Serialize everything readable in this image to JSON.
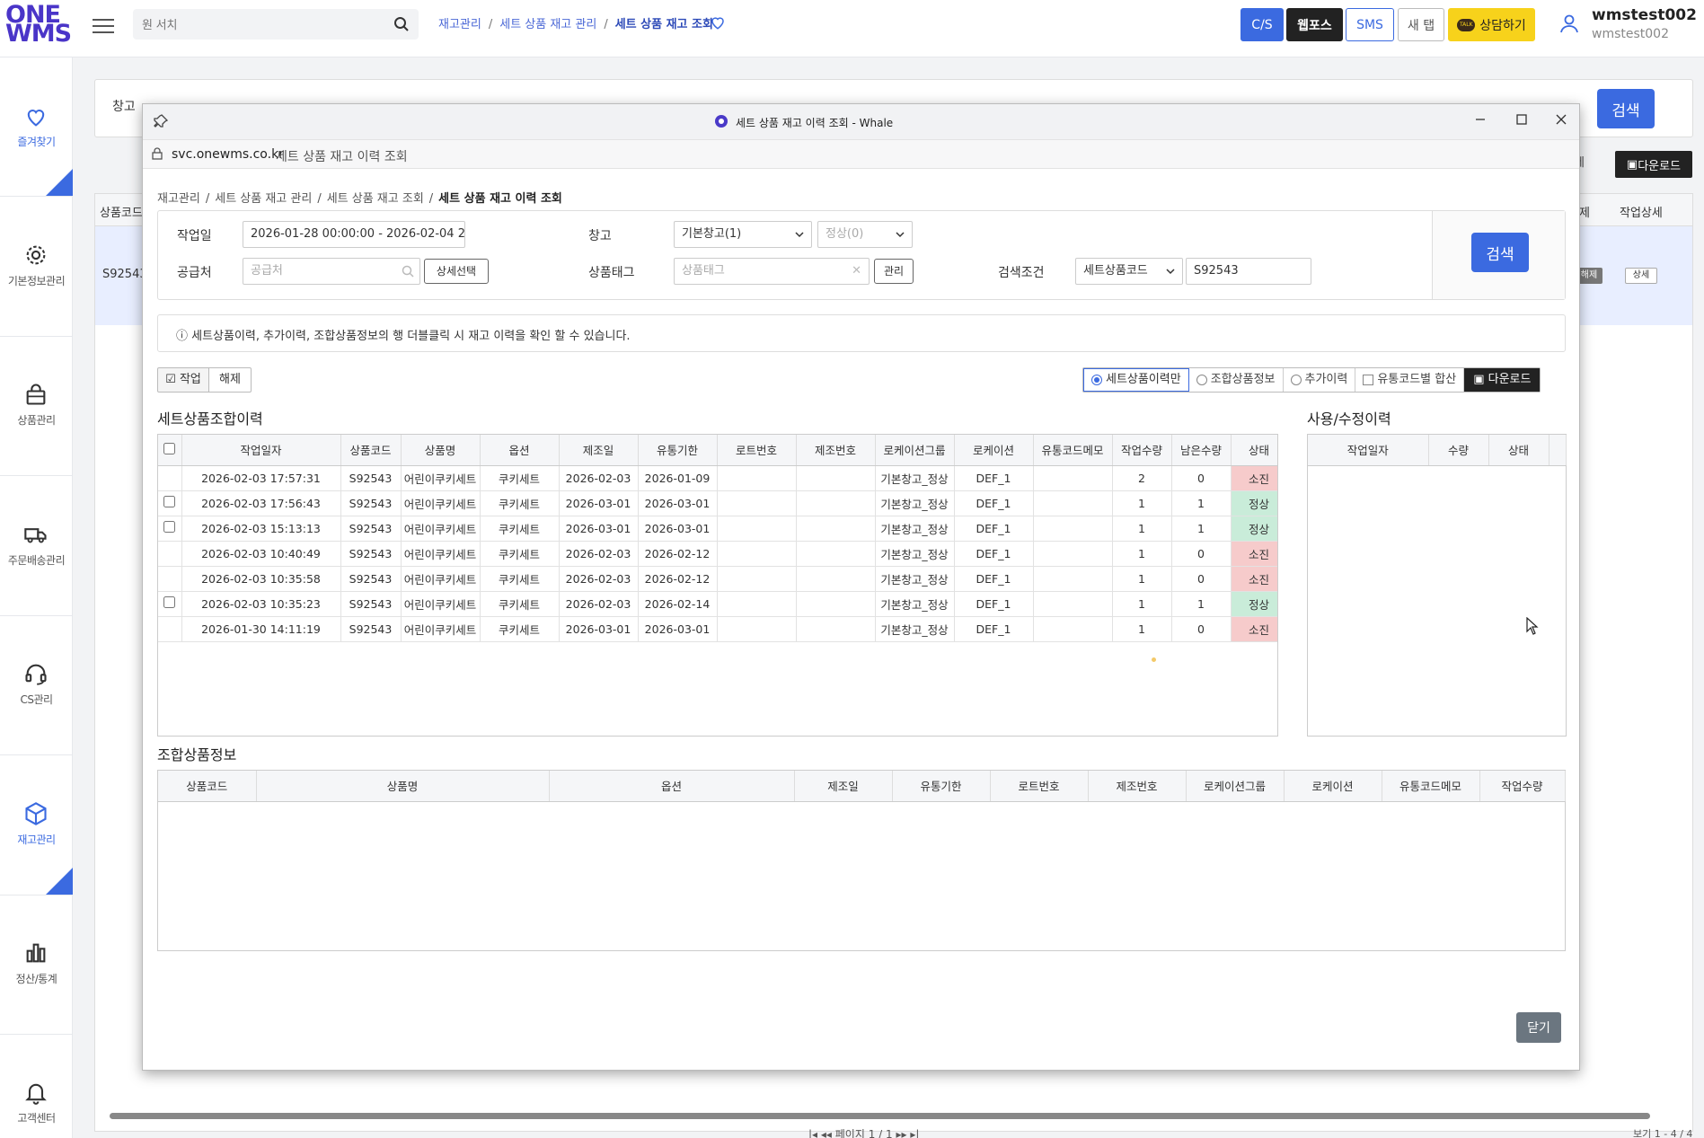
{
  "app": {
    "logo_line1": "ONE",
    "logo_line2": "WMS",
    "search_placeholder": "원 서치",
    "breadcrumb": [
      "재고관리",
      "세트 상품 재고 관리",
      "세트 상품 재고 조회"
    ],
    "buttons": {
      "cs": "C/S",
      "webfos": "웹포스",
      "sms": "SMS",
      "newtab": "새 탭",
      "talk": "상담하기",
      "talk_badge": "TALK"
    },
    "user": {
      "name": "wmstest002",
      "sub": "wmstest002"
    },
    "colors": {
      "primary": "#3b6ae0",
      "logo": "#4a35c8",
      "used": "#f6cbcb",
      "normal": "#c9ecd9"
    }
  },
  "sidebar": {
    "items": [
      {
        "label": "즐겨찾기",
        "icon": "heart-icon"
      },
      {
        "label": "기본정보관리",
        "icon": "gear-icon"
      },
      {
        "label": "상품관리",
        "icon": "bag-icon"
      },
      {
        "label": "주문배송관리",
        "icon": "truck-icon"
      },
      {
        "label": "CS관리",
        "icon": "headset-icon"
      },
      {
        "label": "재고관리",
        "icon": "cube-icon"
      },
      {
        "label": "정산/통계",
        "icon": "bar-chart-icon"
      },
      {
        "label": "고객센터",
        "icon": "bell-icon"
      }
    ]
  },
  "background_page": {
    "warehouse_label": "창고",
    "search": "검색",
    "release": "해제",
    "download": "다운로드",
    "col_code": "상품코드",
    "cell_code": "S92543",
    "col_release": "해제",
    "col_detail": "작업상세",
    "tag_release": "해제",
    "btn_detail": "상세",
    "pager_label": "페이지",
    "pager_value": "1",
    "pager_total": "/ 1",
    "count_text": "보기 1 - 4 / 4"
  },
  "popup": {
    "window_title": "세트 상품 재고 이력 조회 - Whale",
    "url": "svc.onewms.co.kr",
    "url_title": "세트 상품 재고 이력 조회",
    "breadcrumb": [
      "재고관리",
      "세트 상품 재고 관리",
      "세트 상품 재고 조회",
      "세트 상품 재고 이력 조회"
    ],
    "filters": {
      "work_date_label": "작업일",
      "work_date_value": "2026-01-28 00:00:00 - 2026-02-04 23:59:59",
      "warehouse_label": "창고",
      "warehouse_value": "기본창고(1)",
      "status_value": "정상(0)",
      "supplier_label": "공급처",
      "supplier_placeholder": "공급처",
      "detail_select": "상세선택",
      "tag_label": "상품태그",
      "tag_placeholder": "상품태그",
      "manage": "관리",
      "cond_label": "검색조건",
      "cond_value": "세트상품코드",
      "cond_input": "S92543",
      "search": "검색"
    },
    "notice": "ⓘ 세트상품이력, 추가이력, 조합상품정보의 행 더블클릭 시 재고 이력을 확인 할 수 있습니다.",
    "toolbar": {
      "work": "작업",
      "release": "해제",
      "options": [
        "세트상품이력만",
        "조합상품정보",
        "추가이력",
        "유통코드별 합산"
      ],
      "download": "다운로드"
    },
    "set_history": {
      "title": "세트상품조합이력",
      "columns": [
        "작업일자",
        "상품코드",
        "상품명",
        "옵션",
        "제조일",
        "유통기한",
        "로트번호",
        "제조번호",
        "로케이션그룹",
        "로케이션",
        "유통코드메모",
        "작업수량",
        "남은수량",
        "상태"
      ],
      "rows": [
        {
          "checkbox": false,
          "cells": [
            "2026-02-03 17:57:31",
            "S92543",
            "어린이쿠키세트",
            "쿠키세트",
            "2026-02-03",
            "2026-01-09",
            "",
            "",
            "기본창고_정상",
            "DEF_1",
            "",
            "2",
            "0",
            "소진"
          ]
        },
        {
          "checkbox": true,
          "cells": [
            "2026-02-03 17:56:43",
            "S92543",
            "어린이쿠키세트",
            "쿠키세트",
            "2026-03-01",
            "2026-03-01",
            "",
            "",
            "기본창고_정상",
            "DEF_1",
            "",
            "1",
            "1",
            "정상"
          ]
        },
        {
          "checkbox": true,
          "cells": [
            "2026-02-03 15:13:13",
            "S92543",
            "어린이쿠키세트",
            "쿠키세트",
            "2026-03-01",
            "2026-03-01",
            "",
            "",
            "기본창고_정상",
            "DEF_1",
            "",
            "1",
            "1",
            "정상"
          ]
        },
        {
          "checkbox": false,
          "cells": [
            "2026-02-03 10:40:49",
            "S92543",
            "어린이쿠키세트",
            "쿠키세트",
            "2026-02-03",
            "2026-02-12",
            "",
            "",
            "기본창고_정상",
            "DEF_1",
            "",
            "1",
            "0",
            "소진"
          ]
        },
        {
          "checkbox": false,
          "cells": [
            "2026-02-03 10:35:58",
            "S92543",
            "어린이쿠키세트",
            "쿠키세트",
            "2026-02-03",
            "2026-02-12",
            "",
            "",
            "기본창고_정상",
            "DEF_1",
            "",
            "1",
            "0",
            "소진"
          ]
        },
        {
          "checkbox": true,
          "cells": [
            "2026-02-03 10:35:23",
            "S92543",
            "어린이쿠키세트",
            "쿠키세트",
            "2026-02-03",
            "2026-02-14",
            "",
            "",
            "기본창고_정상",
            "DEF_1",
            "",
            "1",
            "1",
            "정상"
          ]
        },
        {
          "checkbox": false,
          "cells": [
            "2026-01-30 14:11:19",
            "S92543",
            "어린이쿠키세트",
            "쿠키세트",
            "2026-03-01",
            "2026-03-01",
            "",
            "",
            "기본창고_정상",
            "DEF_1",
            "",
            "1",
            "0",
            "소진"
          ]
        }
      ]
    },
    "usage_history": {
      "title": "사용/수정이력",
      "columns": [
        "작업일자",
        "수량",
        "상태"
      ]
    },
    "combo_info": {
      "title": "조합상품정보",
      "columns": [
        "상품코드",
        "상품명",
        "옵션",
        "제조일",
        "유통기한",
        "로트번호",
        "제조번호",
        "로케이션그룹",
        "로케이션",
        "유통코드메모",
        "작업수량"
      ]
    },
    "close": "닫기"
  }
}
